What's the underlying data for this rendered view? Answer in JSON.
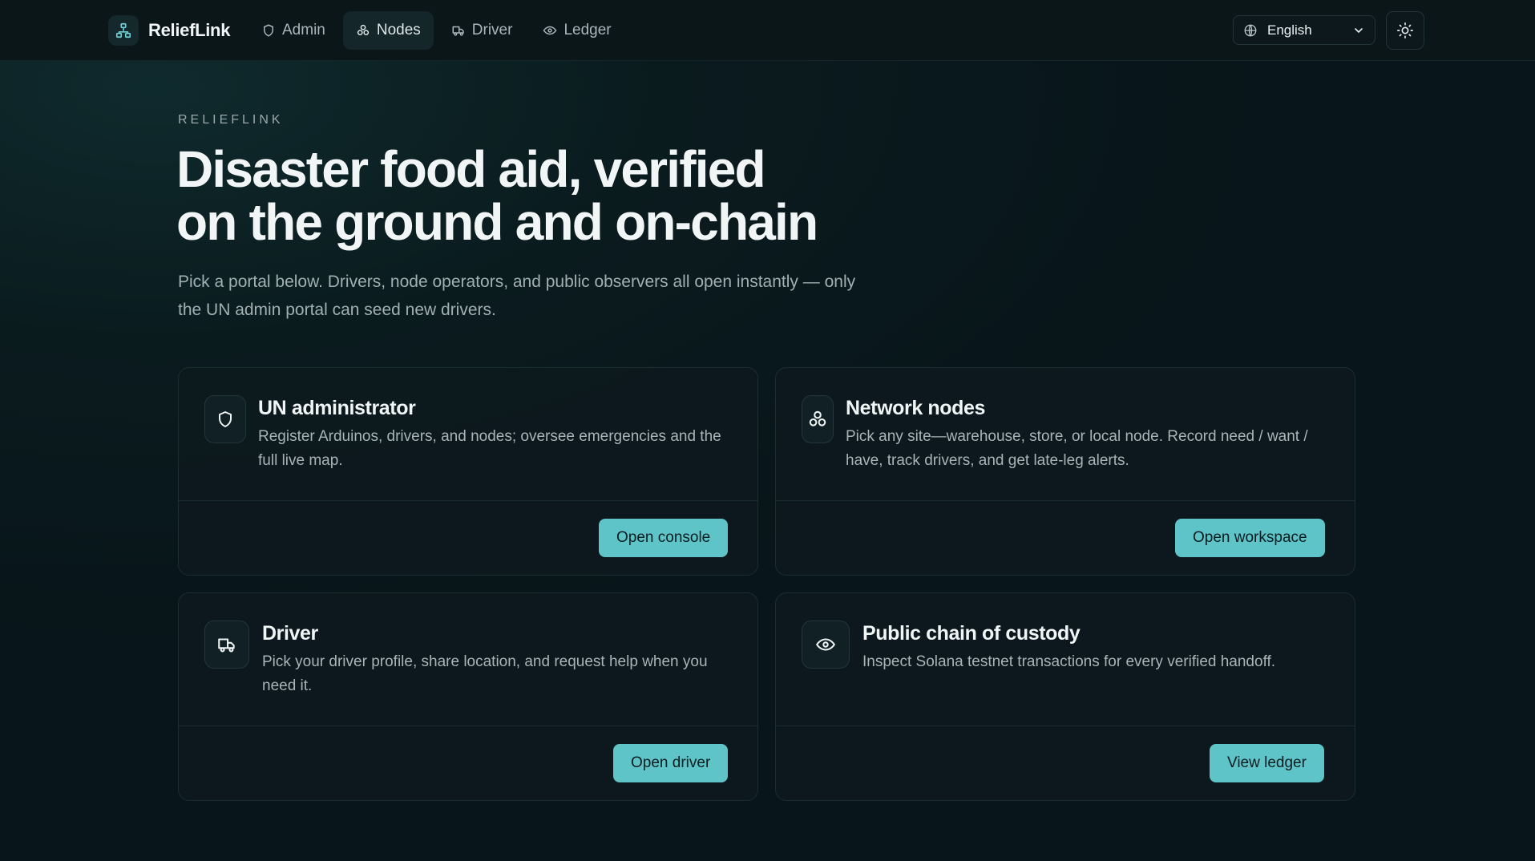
{
  "header": {
    "brand_name": "ReliefLink",
    "nav": [
      {
        "label": "Admin",
        "icon": "shield-icon"
      },
      {
        "label": "Nodes",
        "icon": "nodes-icon",
        "active": true
      },
      {
        "label": "Driver",
        "icon": "truck-icon"
      },
      {
        "label": "Ledger",
        "icon": "eye-icon"
      }
    ],
    "language": {
      "selected": "English"
    },
    "theme_toggle_icon": "sun-icon"
  },
  "hero": {
    "eyebrow": "RELIEFLINK",
    "headline_line1": "Disaster food aid, verified",
    "headline_line2": "on the ground and on-chain",
    "subtext_line1": "Pick a portal below. Drivers, node operators, and public observers all open instantly — only",
    "subtext_line2": "the UN admin portal can seed new drivers."
  },
  "cards": [
    {
      "title": "UN administrator",
      "desc_line1": "Register Arduinos, drivers, and nodes; oversee emergencies and the",
      "desc_line2": "full live map.",
      "button": "Open console",
      "icon": "shield-icon"
    },
    {
      "title": "Network nodes",
      "desc_line1": "Pick any site—warehouse, store, or local node. Record need / want /",
      "desc_line2": "have, track drivers, and get late-leg alerts.",
      "button": "Open workspace",
      "icon": "nodes-icon"
    },
    {
      "title": "Driver",
      "desc_line1": "Pick your driver profile, share location, and request help when you",
      "desc_line2": "need it.",
      "button": "Open driver",
      "icon": "truck-icon"
    },
    {
      "title": "Public chain of custody",
      "desc_line1": "Inspect Solana testnet transactions for every verified handoff.",
      "desc_line2": "",
      "button": "View ledger",
      "icon": "eye-icon"
    }
  ],
  "colors": {
    "accent": "#5ec4c8",
    "background": "#0a1b1e",
    "card": "#0d191d"
  }
}
